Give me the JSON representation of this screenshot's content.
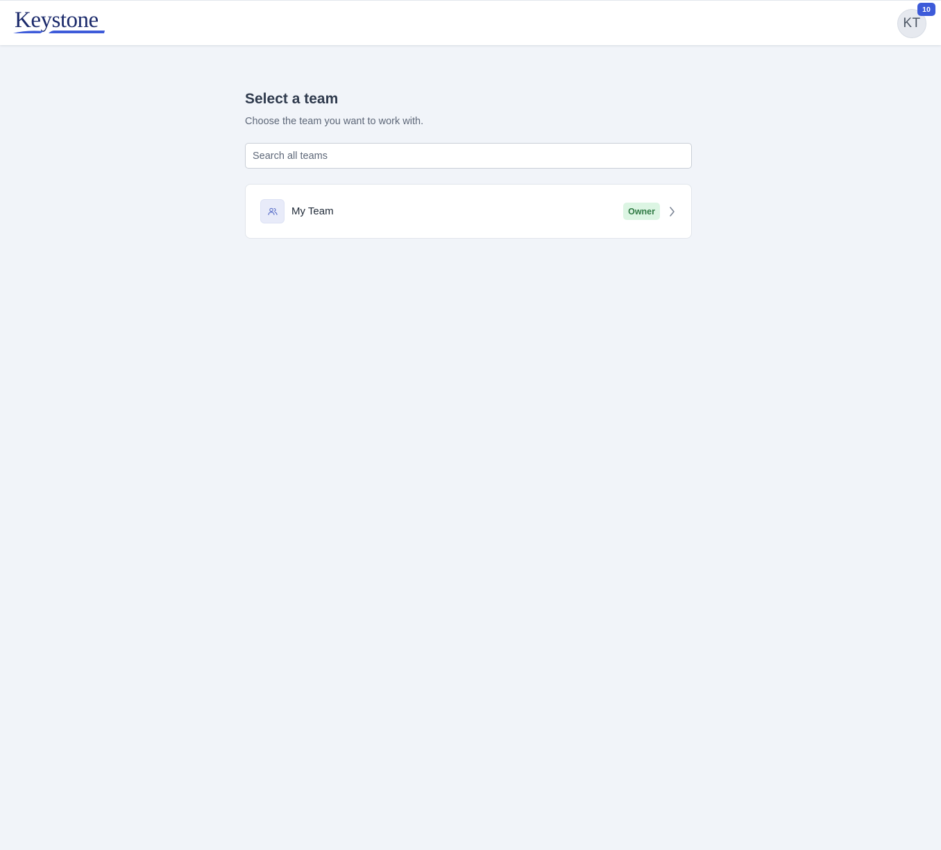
{
  "header": {
    "logo_text": "Keystone",
    "avatar_initials": "KT",
    "notification_count": "10"
  },
  "main": {
    "title": "Select a team",
    "subtitle": "Choose the team you want to work with.",
    "search": {
      "placeholder": "Search all teams",
      "value": ""
    },
    "teams": [
      {
        "name": "My Team",
        "role": "Owner",
        "icon": "users-icon"
      }
    ]
  },
  "colors": {
    "background": "#f1f4f9",
    "brand": "#1b2a6b",
    "accent": "#3d5bd9",
    "owner_badge_bg": "#dcf5e3",
    "owner_badge_text": "#2f7a44"
  }
}
